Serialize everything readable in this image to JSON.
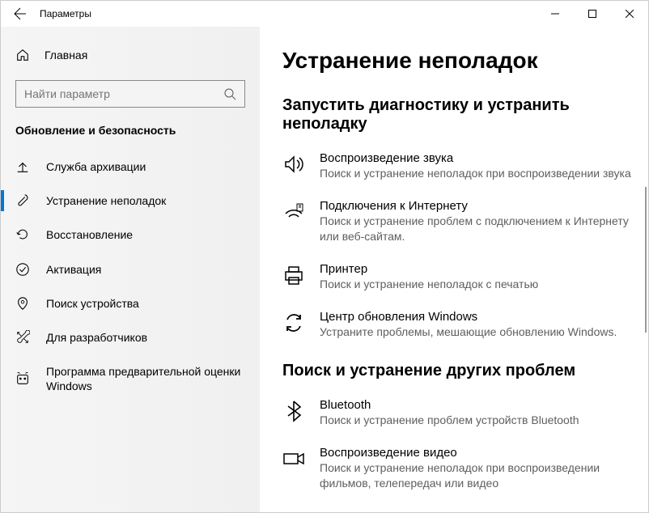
{
  "window": {
    "title": "Параметры"
  },
  "sidebar": {
    "home": "Главная",
    "searchPlaceholder": "Найти параметр",
    "category": "Обновление и безопасность",
    "items": [
      {
        "label": "Служба архивации"
      },
      {
        "label": "Устранение неполадок"
      },
      {
        "label": "Восстановление"
      },
      {
        "label": "Активация"
      },
      {
        "label": "Поиск устройства"
      },
      {
        "label": "Для разработчиков"
      },
      {
        "label": "Программа предварительной оценки Windows"
      }
    ]
  },
  "main": {
    "heading": "Устранение неполадок",
    "section1": {
      "title": "Запустить диагностику и устранить неполадку",
      "items": [
        {
          "title": "Воспроизведение звука",
          "desc": "Поиск и устранение неполадок при воспроизведении звука"
        },
        {
          "title": "Подключения к Интернету",
          "desc": "Поиск и устранение проблем с подключением к Интернету или веб-сайтам."
        },
        {
          "title": "Принтер",
          "desc": "Поиск и устранение неполадок с печатью"
        },
        {
          "title": "Центр обновления Windows",
          "desc": "Устраните проблемы, мешающие обновлению Windows."
        }
      ]
    },
    "section2": {
      "title": "Поиск и устранение других проблем",
      "items": [
        {
          "title": "Bluetooth",
          "desc": "Поиск и устранение проблем устройств Bluetooth"
        },
        {
          "title": "Воспроизведение видео",
          "desc": "Поиск и устранение неполадок при воспроизведении фильмов, телепередач или видео"
        }
      ]
    }
  }
}
